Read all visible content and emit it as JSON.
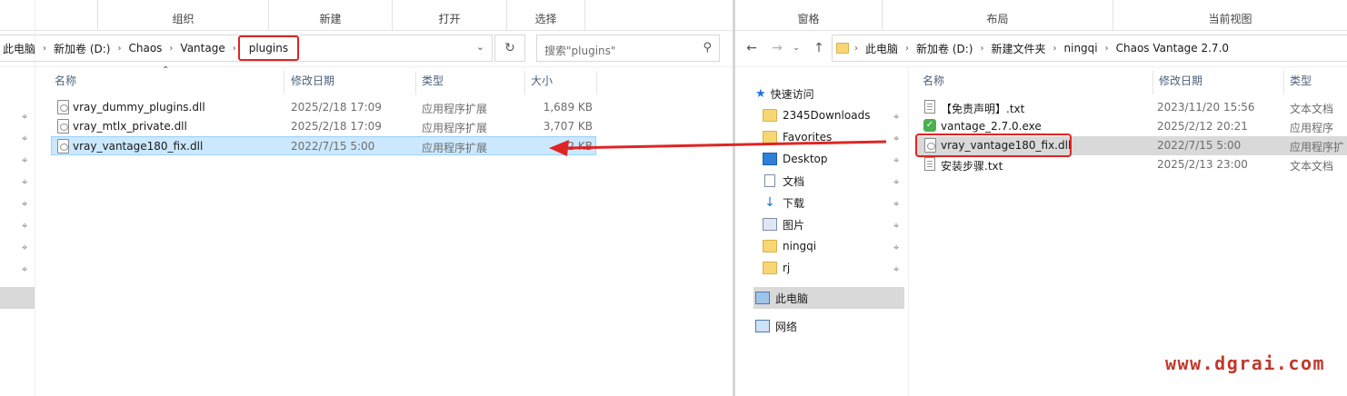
{
  "left": {
    "ribbon": [
      "组织",
      "新建",
      "打开",
      "选择"
    ],
    "breadcrumb": [
      "此电脑",
      "新加卷 (D:)",
      "Chaos",
      "Vantage",
      "plugins"
    ],
    "search_placeholder": "搜索\"plugins\"",
    "columns": [
      "名称",
      "修改日期",
      "类型",
      "大小"
    ],
    "files": [
      {
        "name": "vray_dummy_plugins.dll",
        "date": "2025/2/18 17:09",
        "type": "应用程序扩展",
        "size": "1,689 KB"
      },
      {
        "name": "vray_mtlx_private.dll",
        "date": "2025/2/18 17:09",
        "type": "应用程序扩展",
        "size": "3,707 KB"
      },
      {
        "name": "vray_vantage180_fix.dll",
        "date": "2022/7/15 5:00",
        "type": "应用程序扩展",
        "size": "2 KB"
      }
    ]
  },
  "right": {
    "ribbon": [
      "窗格",
      "布局",
      "当前视图"
    ],
    "breadcrumb": [
      "此电脑",
      "新加卷 (D:)",
      "新建文件夹",
      "ningqi",
      "Chaos Vantage 2.7.0"
    ],
    "columns": [
      "名称",
      "修改日期",
      "类型"
    ],
    "nav": {
      "quick_access": "快速访问",
      "items": [
        "2345Downloads",
        "Favorites",
        "Desktop",
        "文档",
        "下载",
        "图片",
        "ningqi",
        "rj"
      ],
      "this_pc": "此电脑",
      "network": "网络"
    },
    "files": [
      {
        "name": "【免责声明】.txt",
        "date": "2023/11/20 15:56",
        "type": "文本文档",
        "icon": "txt-icon"
      },
      {
        "name": "vantage_2.7.0.exe",
        "date": "2025/2/12 20:21",
        "type": "应用程序",
        "icon": "exe-icon"
      },
      {
        "name": "vray_vantage180_fix.dll",
        "date": "2022/7/15 5:00",
        "type": "应用程序扩",
        "icon": "dll-icon"
      },
      {
        "name": "安装步骤.txt",
        "date": "2025/2/13 23:00",
        "type": "文本文档",
        "icon": "txt-icon"
      }
    ]
  },
  "watermark": "www.dgrai.com",
  "colors": {
    "highlight": "#e02424",
    "selection": "#cce8ff",
    "watermark": "#c0392b"
  }
}
